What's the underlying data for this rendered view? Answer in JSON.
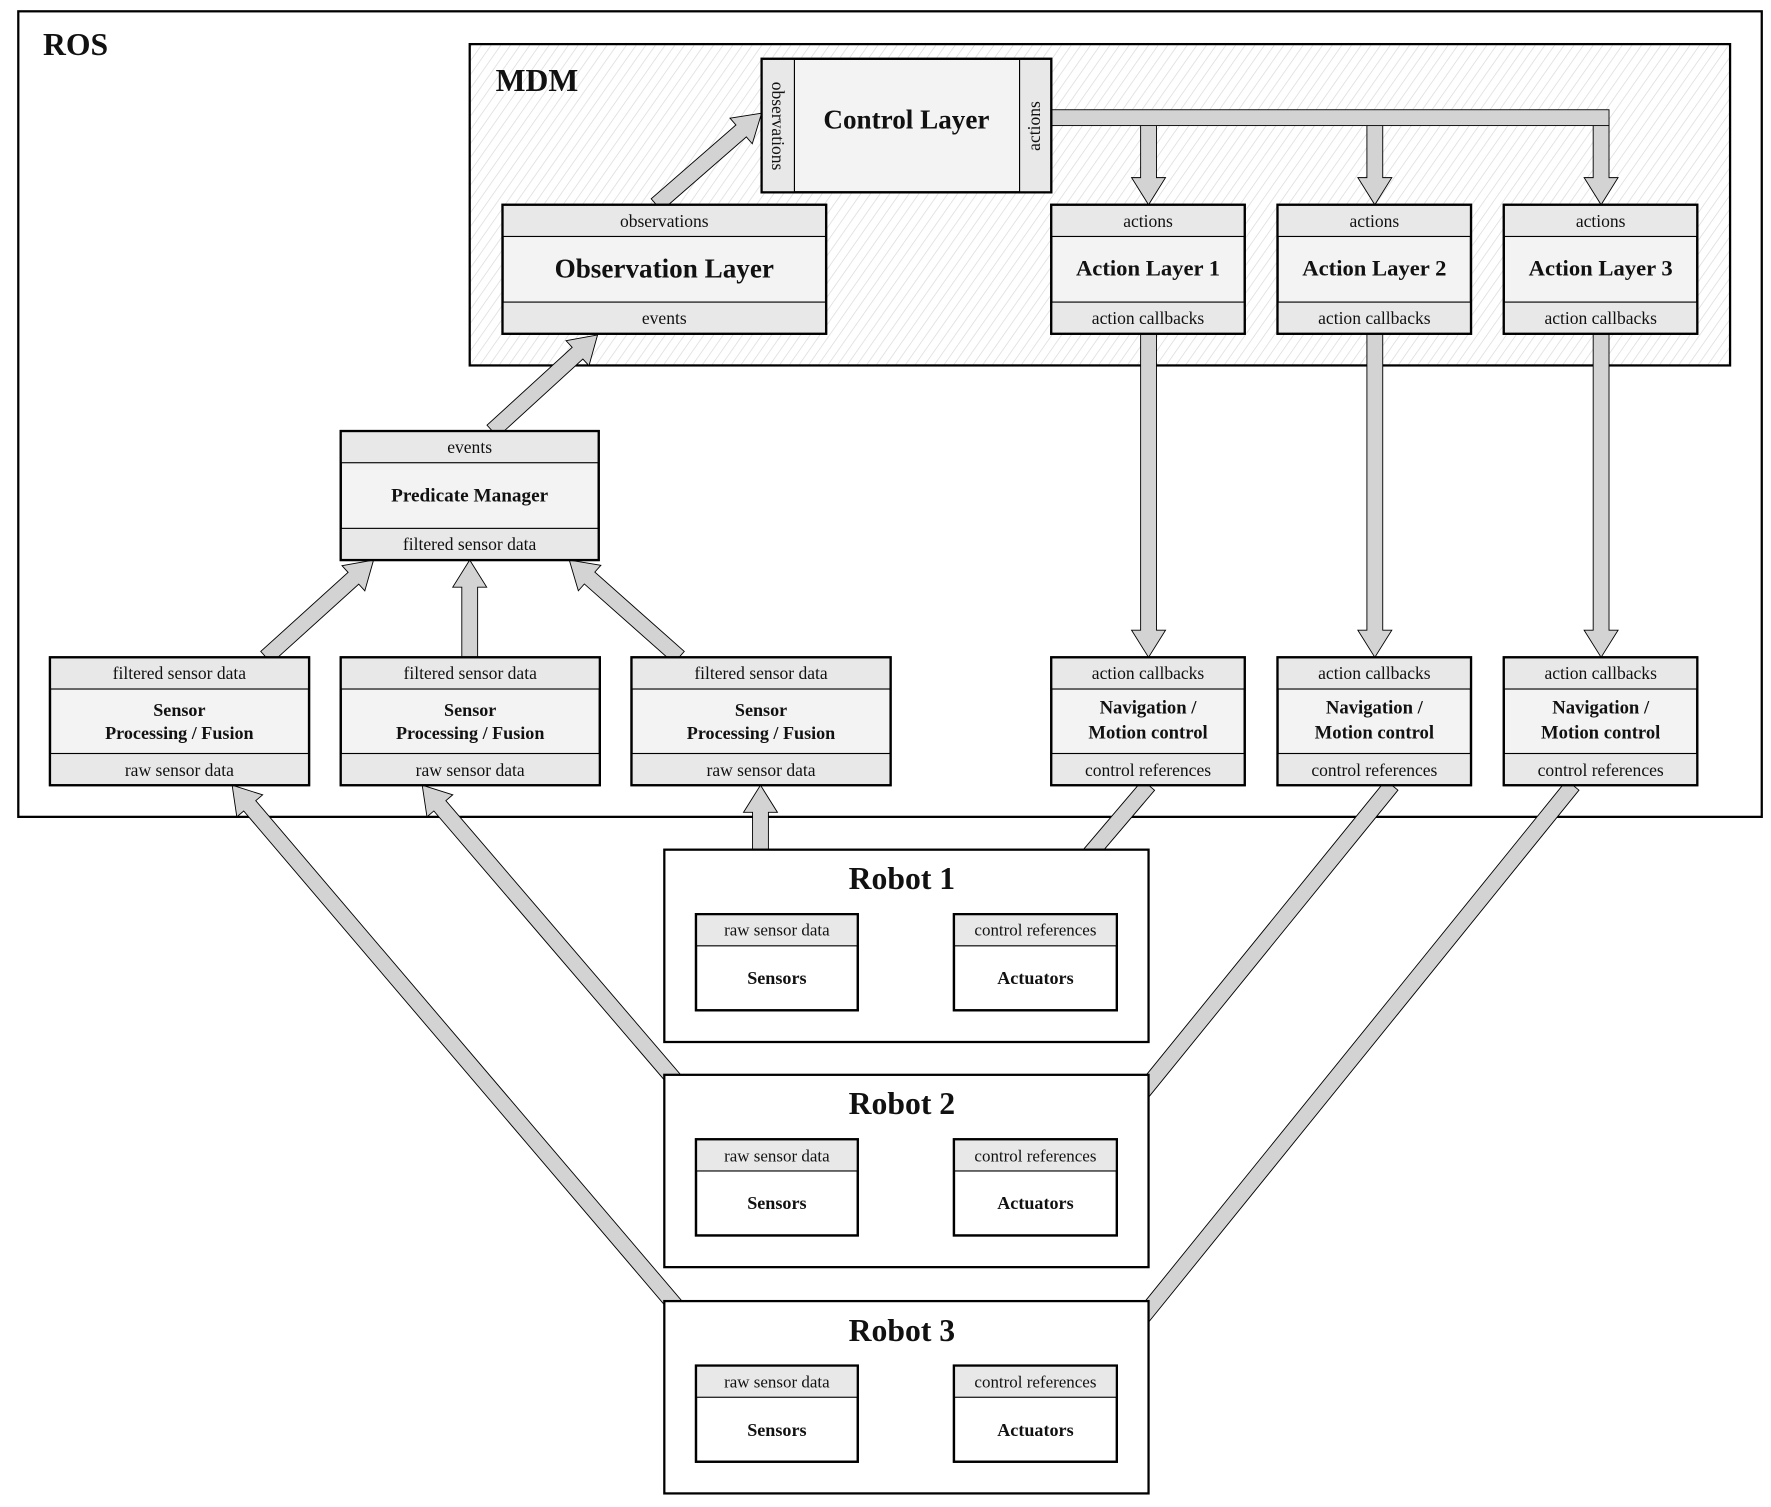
{
  "colors": {
    "arrow_fill": "#d3d3d3",
    "box_fill": "#f3f3f3",
    "strip_fill": "#e8e8e8",
    "stroke": "#000000"
  },
  "ros": {
    "label": "ROS"
  },
  "mdm": {
    "label": "MDM",
    "control_layer": {
      "title": "Control Layer",
      "input": "observations",
      "output": "actions"
    },
    "observation_layer": {
      "header": "observations",
      "title": "Observation Layer",
      "footer": "events"
    },
    "action_layers": [
      {
        "header": "actions",
        "title": "Action Layer 1",
        "footer": "action callbacks"
      },
      {
        "header": "actions",
        "title": "Action Layer 2",
        "footer": "action callbacks"
      },
      {
        "header": "actions",
        "title": "Action Layer 3",
        "footer": "action callbacks"
      }
    ]
  },
  "predicate_manager": {
    "header": "events",
    "title": "Predicate Manager",
    "footer": "filtered sensor data"
  },
  "sensor_processing": [
    {
      "header": "filtered sensor data",
      "title": [
        "Sensor",
        "Processing / Fusion"
      ],
      "footer": "raw sensor data"
    },
    {
      "header": "filtered sensor data",
      "title": [
        "Sensor",
        "Processing / Fusion"
      ],
      "footer": "raw sensor data"
    },
    {
      "header": "filtered sensor data",
      "title": [
        "Sensor",
        "Processing / Fusion"
      ],
      "footer": "raw sensor data"
    }
  ],
  "navigation": [
    {
      "header": "action callbacks",
      "title": [
        "Navigation /",
        "Motion control"
      ],
      "footer": "control references"
    },
    {
      "header": "action callbacks",
      "title": [
        "Navigation /",
        "Motion control"
      ],
      "footer": "control references"
    },
    {
      "header": "action callbacks",
      "title": [
        "Navigation /",
        "Motion control"
      ],
      "footer": "control references"
    }
  ],
  "robots": [
    {
      "title": "Robot 1",
      "sensors": {
        "header": "raw sensor data",
        "title": "Sensors"
      },
      "actuators": {
        "header": "control references",
        "title": "Actuators"
      }
    },
    {
      "title": "Robot 2",
      "sensors": {
        "header": "raw sensor data",
        "title": "Sensors"
      },
      "actuators": {
        "header": "control references",
        "title": "Actuators"
      }
    },
    {
      "title": "Robot 3",
      "sensors": {
        "header": "raw sensor data",
        "title": "Sensors"
      },
      "actuators": {
        "header": "control references",
        "title": "Actuators"
      }
    }
  ]
}
